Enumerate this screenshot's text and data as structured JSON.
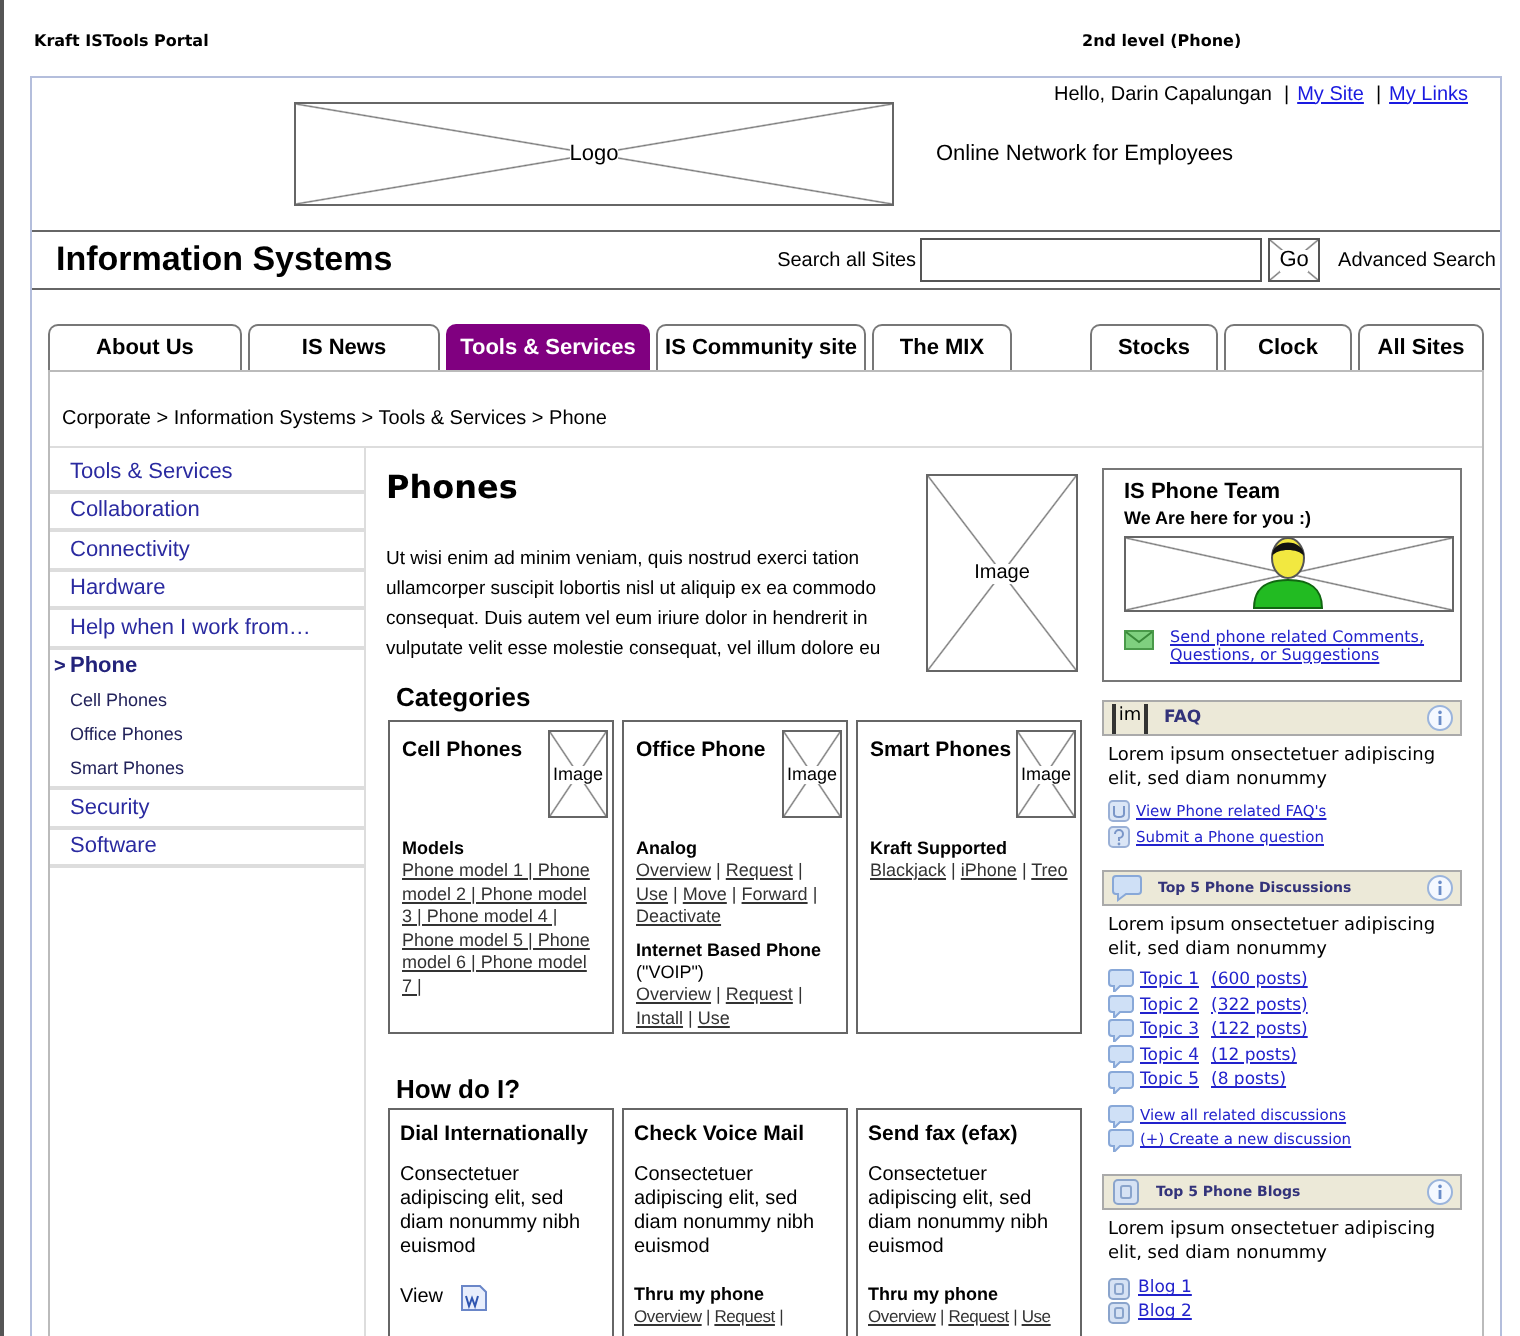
{
  "portal_title": "Kraft ISTools Portal",
  "page_label": "2nd level (Phone)",
  "header": {
    "greeting": "Hello, Darin Capalungan",
    "separator": "|",
    "links": [
      "My Site",
      "My Links"
    ],
    "logo": "Logo",
    "tagline": "Online Network for Employees"
  },
  "site_bar": {
    "title": "Information Systems",
    "search_label": "Search all Sites",
    "search_button": "Go",
    "advanced_link": "Advanced Search"
  },
  "tabs": [
    {
      "label": "About Us",
      "selected": false
    },
    {
      "label": "IS News",
      "selected": false
    },
    {
      "label": "Tools & Services",
      "selected": true
    },
    {
      "label": "IS Community site",
      "selected": false
    },
    {
      "label": "The MIX",
      "selected": false
    }
  ],
  "utility_tabs": [
    {
      "label": "Stocks",
      "selected": false
    },
    {
      "label": "Clock",
      "selected": false
    },
    {
      "label": "All Sites",
      "selected": false
    }
  ],
  "breadcrumb": "Corporate > Information Systems > Tools & Services > Phone",
  "left_nav": {
    "marker": ">",
    "items": [
      {
        "label": "Tools & Services",
        "selected": false
      },
      {
        "label": "Collaboration",
        "selected": false
      },
      {
        "label": "Connectivity",
        "selected": false
      },
      {
        "label": "Hardware",
        "selected": false
      },
      {
        "label": "Help when I work from…",
        "selected": false
      },
      {
        "label": "Phone",
        "selected": true,
        "children": [
          {
            "label": "Cell Phones"
          },
          {
            "label": "Office Phones"
          },
          {
            "label": "Smart Phones"
          }
        ]
      },
      {
        "label": "Security",
        "selected": false
      },
      {
        "label": "Software",
        "selected": false
      }
    ]
  },
  "main": {
    "title": "Phones",
    "intro": "Ut wisi enim ad minim veniam, quis nostrud exerci tation ullamcorper suscipit lobortis nisl ut aliquip ex ea commodo consequat. Duis autem vel eum iriure dolor in hendrerit in vulputate velit esse molestie consequat, vel illum dolore eu",
    "image": "Image",
    "link_separator": "|",
    "categories": {
      "heading": "Categories",
      "cards": [
        {
          "title": "Cell Phones",
          "image": "Image",
          "sections": [
            {
              "heading": "Models",
              "links": [
                "Phone model 1 | Phone model 2 | Phone model 3 | Phone model 4 | Phone model 5 | Phone model 6 | Phone model 7 |"
              ]
            }
          ]
        },
        {
          "title": "Office Phone",
          "image": "Image",
          "sections": [
            {
              "heading": "Analog",
              "links": [
                "Overview",
                "Request",
                "Use",
                "Move",
                "Forward",
                "Deactivate"
              ]
            },
            {
              "heading": "Internet Based Phone",
              "note": "(\"VOIP\")",
              "links": [
                "Overview",
                "Request",
                "Install",
                "Use"
              ]
            }
          ]
        },
        {
          "title": "Smart Phones",
          "image": "Image",
          "sections": [
            {
              "heading": "Kraft Supported",
              "links": [
                "Blackjack",
                "iPhone",
                "Treo"
              ]
            }
          ]
        }
      ]
    },
    "how_do_i": {
      "heading": "How do I?",
      "cards": [
        {
          "title": "Dial Internationally",
          "body": "Consectetuer adipiscing elit, sed diam nonummy nibh euismod",
          "view": "View"
        },
        {
          "title": "Check Voice Mail",
          "body": "Consectetuer adipiscing elit, sed diam nonummy nibh euismod",
          "sections": [
            {
              "heading": "Thru my phone",
              "links": [
                "Overview",
                "Request"
              ],
              "trailing_separator": true
            }
          ]
        },
        {
          "title": "Send fax (efax)",
          "body": "Consectetuer adipiscing elit, sed diam nonummy nibh euismod",
          "sections": [
            {
              "heading": "Thru my phone",
              "links": [
                "Overview",
                "Request",
                "Use"
              ]
            }
          ]
        }
      ]
    }
  },
  "team": {
    "title": "IS Phone Team",
    "subtitle": "We Are here for you :)",
    "link": "Send phone related Comments, Questions, or Suggestions"
  },
  "widgets": [
    {
      "kind": "faq",
      "icon_label": "im",
      "title": "FAQ",
      "body": "Lorem ipsum onsectetuer adipiscing elit, sed diam nonummy",
      "links": [
        "View Phone related FAQ's",
        "Submit a Phone question"
      ]
    },
    {
      "kind": "discussions",
      "title": "Top 5 Phone Discussions",
      "body": "Lorem ipsum onsectetuer adipiscing elit, sed diam nonummy",
      "topics": [
        {
          "title": "Topic 1",
          "posts": "(600 posts)"
        },
        {
          "title": "Topic 2",
          "posts": "(322 posts)"
        },
        {
          "title": "Topic 3",
          "posts": "(122 posts)"
        },
        {
          "title": "Topic 4",
          "posts": "(12 posts)"
        },
        {
          "title": "Topic 5",
          "posts": "(8 posts)"
        }
      ],
      "links": [
        "View all related discussions",
        "(+) Create a new discussion"
      ]
    },
    {
      "kind": "blogs",
      "title": "Top 5 Phone Blogs",
      "body": "Lorem ipsum onsectetuer adipiscing elit, sed diam nonummy",
      "items": [
        "Blog 1",
        "Blog 2"
      ]
    }
  ]
}
